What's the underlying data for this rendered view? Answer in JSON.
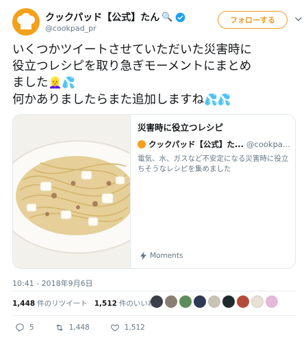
{
  "author": {
    "display_name": "クックパッド【公式】たん",
    "name_emoji": "🔍",
    "screen_name": "@cookpad_pr",
    "verified": true
  },
  "follow_button": {
    "label": "フォローする"
  },
  "tweet": {
    "lines": [
      "いくつかツイートさせていただいた災害時に",
      "役立つレシピを取り急ぎモーメントにまとめ",
      "ました",
      "何かありましたらまた追加しますね"
    ],
    "emoji_line3": "👱‍♀️💦",
    "emoji_line4": "💦💦"
  },
  "card": {
    "title": "災害時に役立つレシピ",
    "author_name": "クックパッド【公式】た...",
    "author_handle": "@cookpa...",
    "description": "電気、水、ガスなど不安定になる災害時に役立ちそうなレシピを集めました",
    "footer_label": "Moments"
  },
  "timestamp": "10:41 - 2018年9月6日",
  "stats": {
    "retweets_count": "1,448",
    "retweets_label": "件のリツイート",
    "likes_count": "1,512",
    "likes_label": "件のいいね"
  },
  "actions": {
    "replies": "5",
    "retweets": "1,448",
    "likes": "1,512"
  },
  "colors": {
    "accent": "#f09a23",
    "verified": "#1da1f2",
    "secondary_text": "#657786"
  },
  "icons": [
    "chef-hat-icon",
    "verified-badge-icon",
    "chevron-down-icon",
    "moments-bolt-icon",
    "reply-icon",
    "retweet-icon",
    "like-heart-icon"
  ]
}
